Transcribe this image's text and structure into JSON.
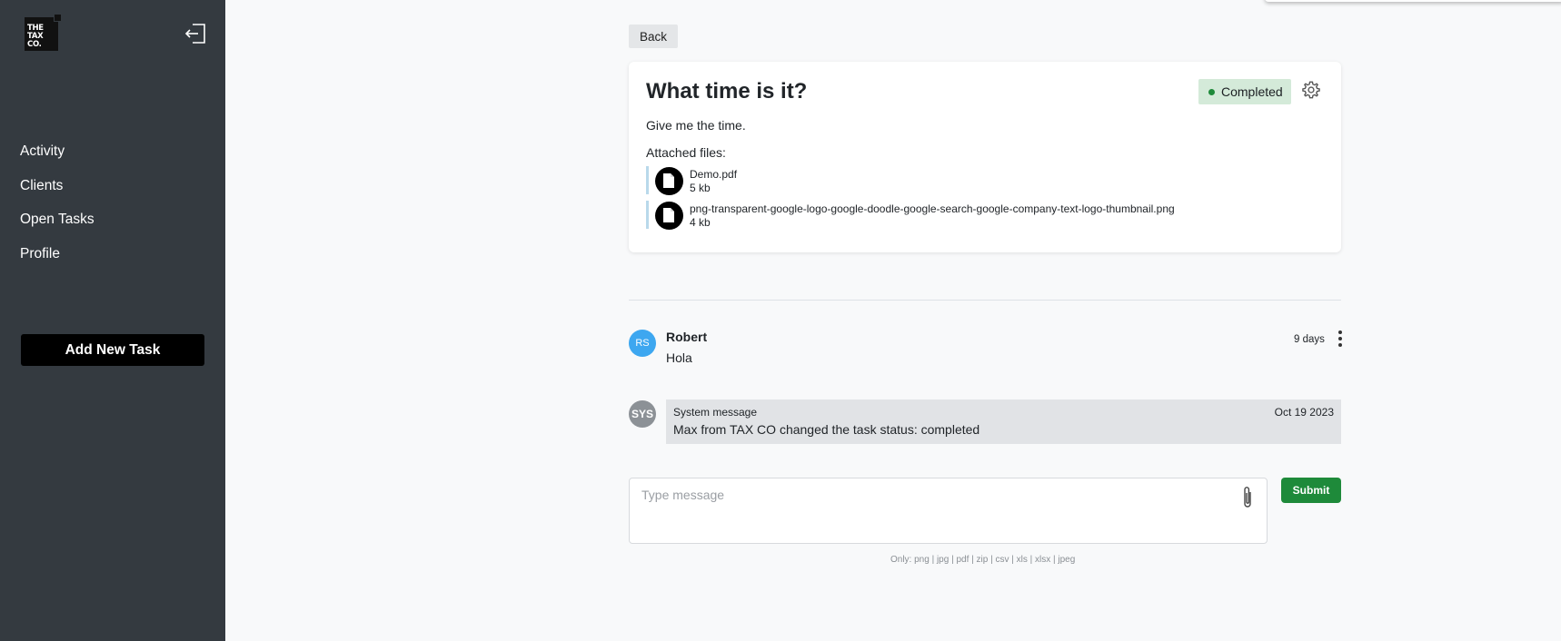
{
  "sidebar": {
    "logo_lines": [
      "THE",
      "TAX",
      "CO."
    ],
    "nav_items": [
      {
        "label": "Activity"
      },
      {
        "label": "Clients"
      },
      {
        "label": "Open Tasks"
      },
      {
        "label": "Profile"
      }
    ],
    "add_task_label": "Add New Task",
    "logout_icon": "logout-icon"
  },
  "main": {
    "back_label": "Back",
    "task": {
      "title": "What time is it?",
      "status": "Completed",
      "status_color": "#1e8a3a",
      "description": "Give me the time.",
      "attached_label": "Attached files:",
      "files": [
        {
          "name": "Demo.pdf",
          "size": "5 kb"
        },
        {
          "name": "png-transparent-google-logo-google-doodle-google-search-google-company-text-logo-thumbnail.png",
          "size": "4 kb"
        }
      ]
    },
    "messages": [
      {
        "initials": "RS",
        "author": "Robert",
        "text": "Hola",
        "time": "9 days",
        "avatar_color": "#3da7f0"
      }
    ],
    "system_message": {
      "initials": "SYS",
      "label": "System message",
      "date": "Oct 19 2023",
      "text": "Max from TAX CO changed the task status: completed"
    },
    "composer": {
      "placeholder": "Type message",
      "submit_label": "Submit",
      "allowed_types": "Only: png | jpg | pdf | zip | csv | xls | xlsx | jpeg"
    }
  },
  "colors": {
    "sidebar_bg": "#343a40",
    "accent_green": "#1e8a3a",
    "avatar_blue": "#3da7f0"
  }
}
